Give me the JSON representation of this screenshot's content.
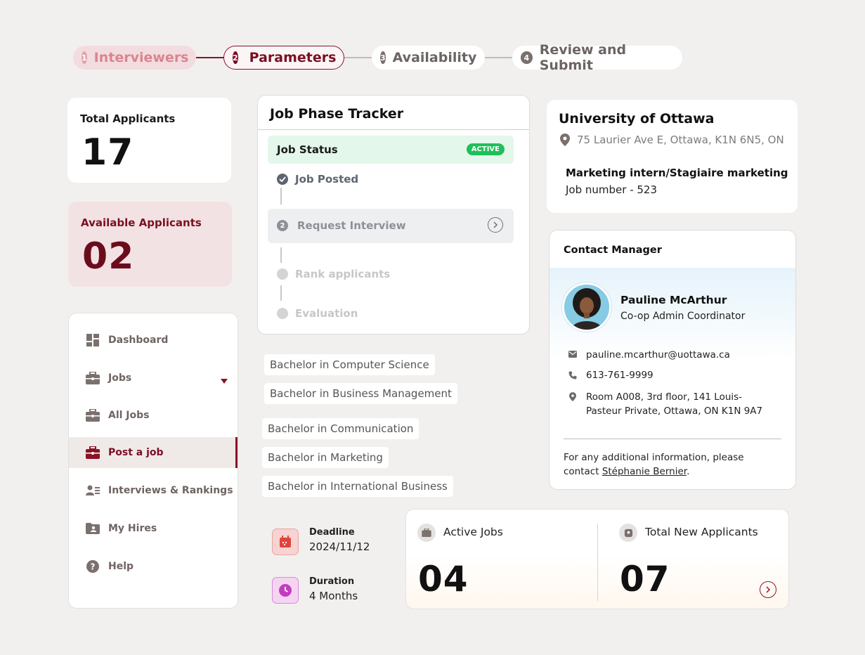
{
  "stepper": {
    "steps": [
      {
        "number": "1",
        "label": "Interviewers"
      },
      {
        "number": "2",
        "label": "Parameters"
      },
      {
        "number": "3",
        "label": "Availability"
      },
      {
        "number": "4",
        "label": "Review and Submit"
      }
    ],
    "active_index": 1
  },
  "stats": {
    "total_label": "Total Applicants",
    "total_value": "17",
    "available_label": "Available Applicants",
    "available_value": "02"
  },
  "sidebar": {
    "items": [
      {
        "label": "Dashboard",
        "icon": "dashboard-icon"
      },
      {
        "label": "Jobs",
        "icon": "briefcase-icon",
        "expandable": true
      },
      {
        "label": "All Jobs",
        "icon": "briefcase-icon"
      },
      {
        "label": "Post a job",
        "icon": "briefcase-icon",
        "active": true
      },
      {
        "label": "Interviews & Rankings",
        "icon": "people-list-icon"
      },
      {
        "label": "My Hires",
        "icon": "folder-person-icon"
      },
      {
        "label": "Help",
        "icon": "help-icon"
      }
    ]
  },
  "tracker": {
    "title": "Job Phase Tracker",
    "status_label": "Job Status",
    "status_badge": "ACTIVE",
    "phases": [
      {
        "label": "Job Posted",
        "state": "done"
      },
      {
        "label": "Request Interview",
        "state": "current",
        "number": "2"
      },
      {
        "label": "Rank applicants",
        "state": "pending"
      },
      {
        "label": "Evaluation",
        "state": "pending"
      }
    ]
  },
  "programs": [
    "Bachelor in Computer Science",
    "Bachelor in Business Management",
    "Bachelor in Communication",
    "Bachelor in Marketing",
    "Bachelor in International Business"
  ],
  "schedule": {
    "deadline_label": "Deadline",
    "deadline_value": "2024/11/12",
    "duration_label": "Duration",
    "duration_value": "4 Months"
  },
  "summary": {
    "active_jobs_label": "Active Jobs",
    "active_jobs_value": "04",
    "new_applicants_label": "Total New Applicants",
    "new_applicants_value": "07"
  },
  "employer": {
    "name": "University of Ottawa",
    "address": "75 Laurier Ave E, Ottawa, K1N 6N5, ON",
    "job_title": "Marketing intern/Stagiaire marketing",
    "job_number": "Job number - 523"
  },
  "contact": {
    "header": "Contact Manager",
    "name": "Pauline McArthur",
    "role": "Co-op Admin Coordinator",
    "email": "pauline.mcarthur@uottawa.ca",
    "phone": "613-761-9999",
    "address_line1": "Room A008, 3rd floor, 141 Louis-",
    "address_line2": "Pasteur Private, Ottawa, ON K1N 9A7",
    "footer_text": "For any additional information, please contact ",
    "footer_link": "Stéphanie Bernier",
    "footer_end": "."
  },
  "colors": {
    "brand": "#8a1326",
    "active_green": "#1fbf5a",
    "status_bg": "#e3f7ea",
    "available_bg": "#f3e2e3"
  }
}
